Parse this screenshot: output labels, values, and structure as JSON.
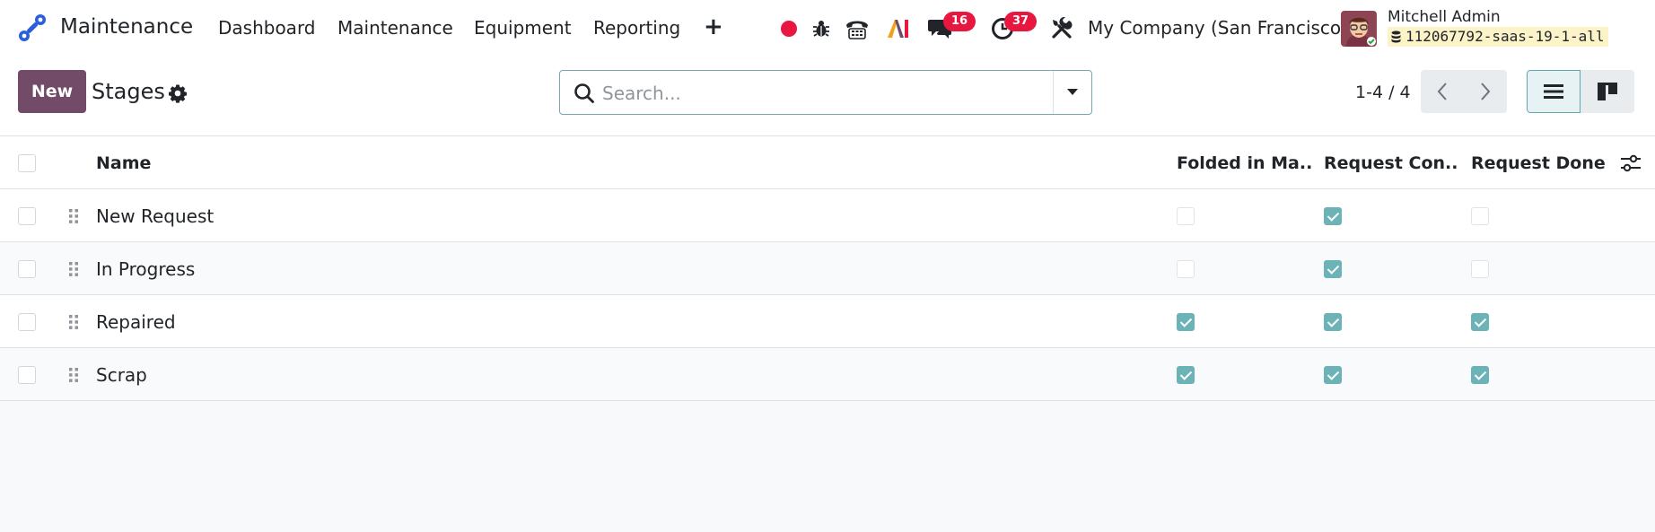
{
  "navbar": {
    "app_name": "Maintenance",
    "menu": [
      "Dashboard",
      "Maintenance",
      "Equipment",
      "Reporting"
    ],
    "messages_count": "16",
    "activities_count": "37",
    "company": "My Company (San Francisco)",
    "user_name": "Mitchell Admin",
    "database": "112067792-saas-19-1-all",
    "icons": [
      "app-logo-icon",
      "plus-icon",
      "recording-dot-icon",
      "bug-icon",
      "phone-icon",
      "ai-icon",
      "chat-icon",
      "clock-icon",
      "tools-icon",
      "database-icon"
    ]
  },
  "control_panel": {
    "new_label": "New",
    "title": "Stages",
    "search_placeholder": "Search...",
    "pager": "1-4 / 4"
  },
  "table": {
    "columns": [
      "Name",
      "Folded in Ma...",
      "Request Con...",
      "Request Done"
    ],
    "rows": [
      {
        "name": "New Request",
        "folded": false,
        "confirmed": true,
        "done": false
      },
      {
        "name": "In Progress",
        "folded": false,
        "confirmed": true,
        "done": false
      },
      {
        "name": "Repaired",
        "folded": true,
        "confirmed": true,
        "done": true
      },
      {
        "name": "Scrap",
        "folded": true,
        "confirmed": true,
        "done": true
      }
    ]
  },
  "colors": {
    "brand": "#714b67",
    "accent": "#6bb3b6",
    "badge": "#e8173f"
  }
}
